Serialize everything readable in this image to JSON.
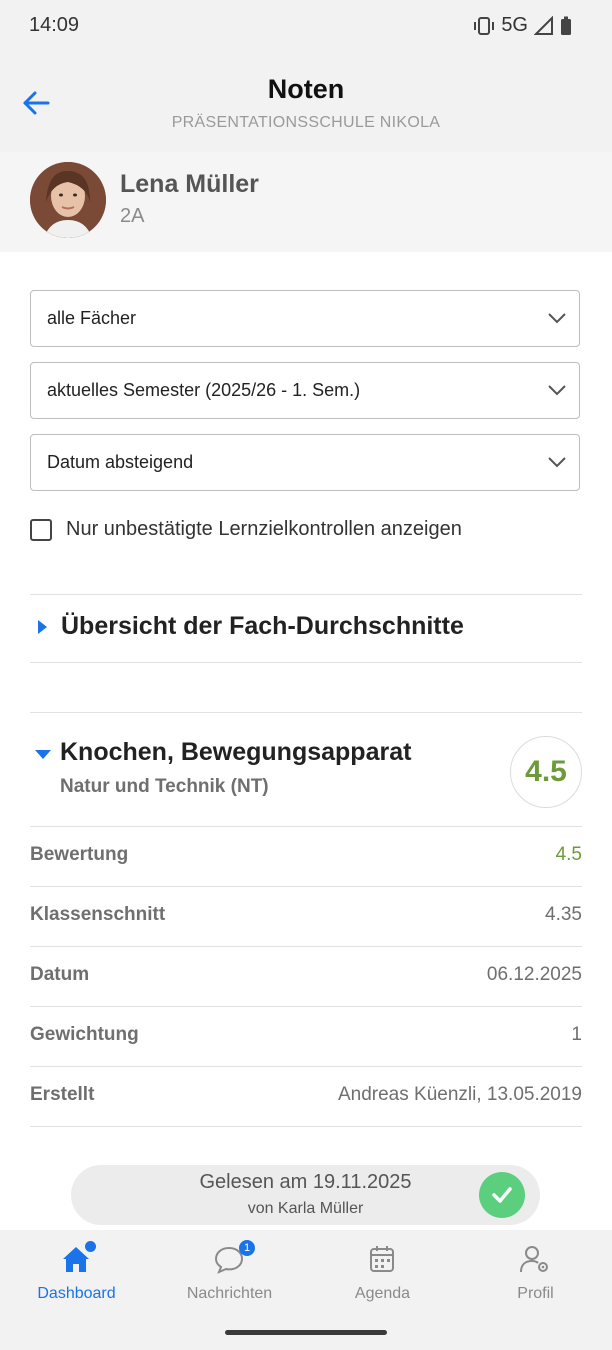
{
  "status": {
    "time": "14:09",
    "network": "5G"
  },
  "appbar": {
    "title": "Noten",
    "subtitle": "PRÄSENTATIONSSCHULE NIKOLA"
  },
  "student": {
    "name": "Lena Müller",
    "class": "2A"
  },
  "filters": {
    "subject": "alle Fächer",
    "semester": "aktuelles Semester (2025/26 - 1. Sem.)",
    "sort": "Datum absteigend",
    "checkbox_label": "Nur unbestätigte Lernzielkontrollen anzeigen",
    "checkbox_checked": false
  },
  "overview": {
    "title": "Übersicht der Fach-Durchschnitte"
  },
  "grade": {
    "title": "Knochen, Bewegungsapparat",
    "subject": "Natur und Technik (NT)",
    "score": "4.5",
    "rows": [
      {
        "label": "Bewertung",
        "value": "4.5"
      },
      {
        "label": "Klassenschnitt",
        "value": "4.35"
      },
      {
        "label": "Datum",
        "value": "06.12.2025"
      },
      {
        "label": "Gewichtung",
        "value": "1"
      },
      {
        "label": "Erstellt",
        "value": "Andreas Küenzli, 13.05.2019"
      }
    ]
  },
  "read": {
    "line1": "Gelesen am 19.11.2025",
    "line2": "von Karla Müller"
  },
  "nav": {
    "items": [
      {
        "label": "Dashboard",
        "icon": "home-icon"
      },
      {
        "label": "Nachrichten",
        "icon": "chat-icon",
        "badge": "1"
      },
      {
        "label": "Agenda",
        "icon": "calendar-icon"
      },
      {
        "label": "Profil",
        "icon": "profile-settings-icon"
      }
    ]
  },
  "colors": {
    "accent": "#1a73e8",
    "grade_good": "#6e9b3a",
    "read_check": "#5ccf7f"
  }
}
